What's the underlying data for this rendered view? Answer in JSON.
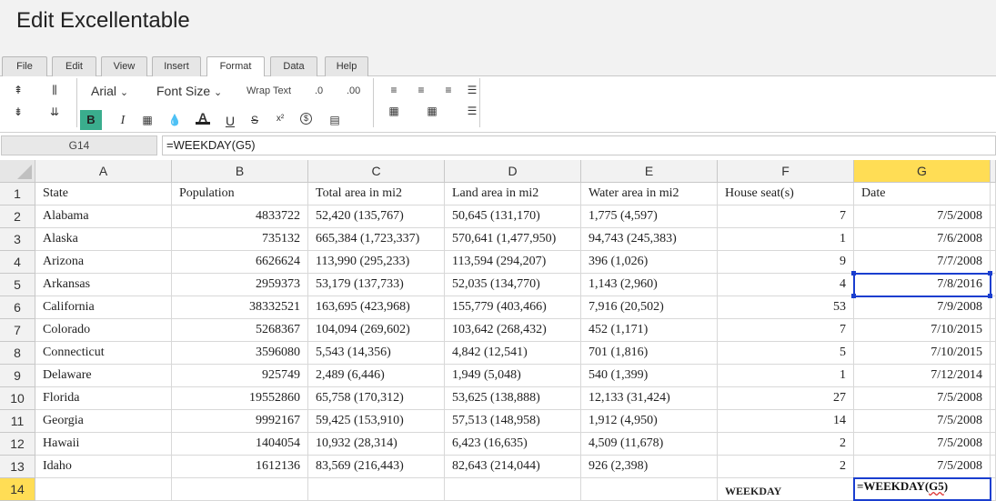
{
  "app": {
    "title": "Edit Excellentable"
  },
  "menu": {
    "tabs": [
      {
        "label": "File",
        "active": false
      },
      {
        "label": "Edit",
        "active": false
      },
      {
        "label": "View",
        "active": false
      },
      {
        "label": "Insert",
        "active": false
      },
      {
        "label": "Format",
        "active": true
      },
      {
        "label": "Data",
        "active": false
      },
      {
        "label": "Help",
        "active": false
      }
    ]
  },
  "toolbar": {
    "font_name": "Arial",
    "font_size": "Font Size",
    "wrap_text": "Wrap Text",
    "decrease_decimal": ".0",
    "increase_decimal": ".00",
    "bold_label": "B",
    "italic_label": "I",
    "font_color_label": "A",
    "underline_label": "U",
    "strikethrough_label": "S",
    "superscript_label": "x²",
    "currency_label": "$",
    "accent_color": "#3aad8d"
  },
  "formula_bar": {
    "cell_ref": "G14",
    "formula": "=WEEKDAY(G5)"
  },
  "grid": {
    "columns": [
      "A",
      "B",
      "C",
      "D",
      "E",
      "F",
      "G"
    ],
    "selected_column": "G",
    "rows": [
      {
        "n": "1",
        "cells": [
          "State",
          "Population",
          "Total area in mi2",
          "Land area in mi2",
          "Water area in mi2",
          "House seat(s)",
          "Date"
        ]
      },
      {
        "n": "2",
        "cells": [
          "Alabama",
          "4833722",
          "52,420 (135,767)",
          "50,645 (131,170)",
          "1,775 (4,597)",
          "7",
          "7/5/2008"
        ]
      },
      {
        "n": "3",
        "cells": [
          "Alaska",
          "735132",
          "665,384 (1,723,337)",
          "570,641 (1,477,950)",
          "94,743 (245,383)",
          "1",
          "7/6/2008"
        ]
      },
      {
        "n": "4",
        "cells": [
          "Arizona",
          "6626624",
          "113,990 (295,233)",
          "113,594 (294,207)",
          "396 (1,026)",
          "9",
          "7/7/2008"
        ]
      },
      {
        "n": "5",
        "cells": [
          "Arkansas",
          "2959373",
          "53,179 (137,733)",
          "52,035 (134,770)",
          "1,143 (2,960)",
          "4",
          "7/8/2016"
        ]
      },
      {
        "n": "6",
        "cells": [
          "California",
          "38332521",
          "163,695 (423,968)",
          "155,779 (403,466)",
          "7,916 (20,502)",
          "53",
          "7/9/2008"
        ]
      },
      {
        "n": "7",
        "cells": [
          "Colorado",
          "5268367",
          "104,094 (269,602)",
          "103,642 (268,432)",
          "452 (1,171)",
          "7",
          "7/10/2015"
        ]
      },
      {
        "n": "8",
        "cells": [
          "Connecticut",
          "3596080",
          "5,543 (14,356)",
          "4,842 (12,541)",
          "701 (1,816)",
          "5",
          "7/10/2015"
        ]
      },
      {
        "n": "9",
        "cells": [
          "Delaware",
          "925749",
          "2,489 (6,446)",
          "1,949 (5,048)",
          "540 (1,399)",
          "1",
          "7/12/2014"
        ]
      },
      {
        "n": "10",
        "cells": [
          "Florida",
          "19552860",
          "65,758 (170,312)",
          "53,625 (138,888)",
          "12,133 (31,424)",
          "27",
          "7/5/2008"
        ]
      },
      {
        "n": "11",
        "cells": [
          "Georgia",
          "9992167",
          "59,425 (153,910)",
          "57,513 (148,958)",
          "1,912 (4,950)",
          "14",
          "7/5/2008"
        ]
      },
      {
        "n": "12",
        "cells": [
          "Hawaii",
          "1404054",
          "10,932 (28,314)",
          "6,423 (16,635)",
          "4,509 (11,678)",
          "2",
          "7/5/2008"
        ]
      },
      {
        "n": "13",
        "cells": [
          "Idaho",
          "1612136",
          "83,569 (216,443)",
          "82,643 (214,044)",
          "926 (2,398)",
          "2",
          "7/5/2008"
        ]
      },
      {
        "n": "14",
        "cells": [
          "",
          "",
          "",
          "",
          "",
          "WEEKDAY",
          ""
        ]
      }
    ],
    "editing_cell": {
      "ref": "G14",
      "formula_prefix": "=WEEKDAY(",
      "formula_ref": "G5",
      "formula_suffix": ")"
    },
    "highlight_cell": "G5"
  }
}
